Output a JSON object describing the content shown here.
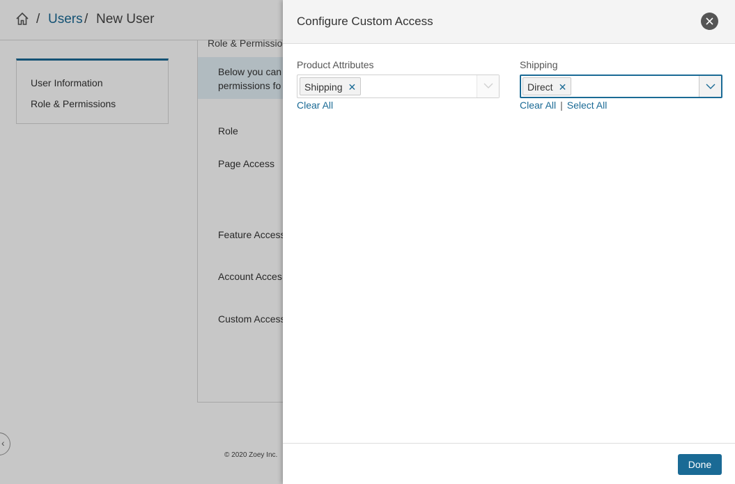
{
  "breadcrumb": {
    "separator": "/",
    "users": "Users",
    "current": "New User"
  },
  "sidebar": {
    "items": [
      {
        "label": "User Information"
      },
      {
        "label": "Role & Permissions"
      }
    ]
  },
  "main": {
    "section_title": "Role & Permissio",
    "info_text_line1": "Below you can",
    "info_text_line2": "permissions fo",
    "fields": {
      "role": "Role",
      "page_access": "Page Access",
      "feature_access": "Feature Access",
      "account_access": "Account Acces",
      "custom_access": "Custom Access"
    }
  },
  "footer": {
    "copyright": "© 2020 Zoey Inc."
  },
  "drawer": {
    "title": "Configure Custom Access",
    "groups": [
      {
        "label": "Product Attributes",
        "selected": [
          "Shipping"
        ],
        "clear_all": "Clear All"
      },
      {
        "label": "Shipping",
        "selected": [
          "Direct"
        ],
        "clear_all": "Clear All",
        "select_all": "Select All",
        "link_separator": "|"
      }
    ],
    "done_label": "Done"
  },
  "colors": {
    "accent": "#1a6a95",
    "overlay": "rgba(0,0,0,0.22)"
  },
  "icons": {
    "home": "home-icon",
    "close": "close-icon",
    "remove_tag": "close-x-icon",
    "dropdown": "chevron-down-icon",
    "collapse": "chevron-left-icon"
  }
}
